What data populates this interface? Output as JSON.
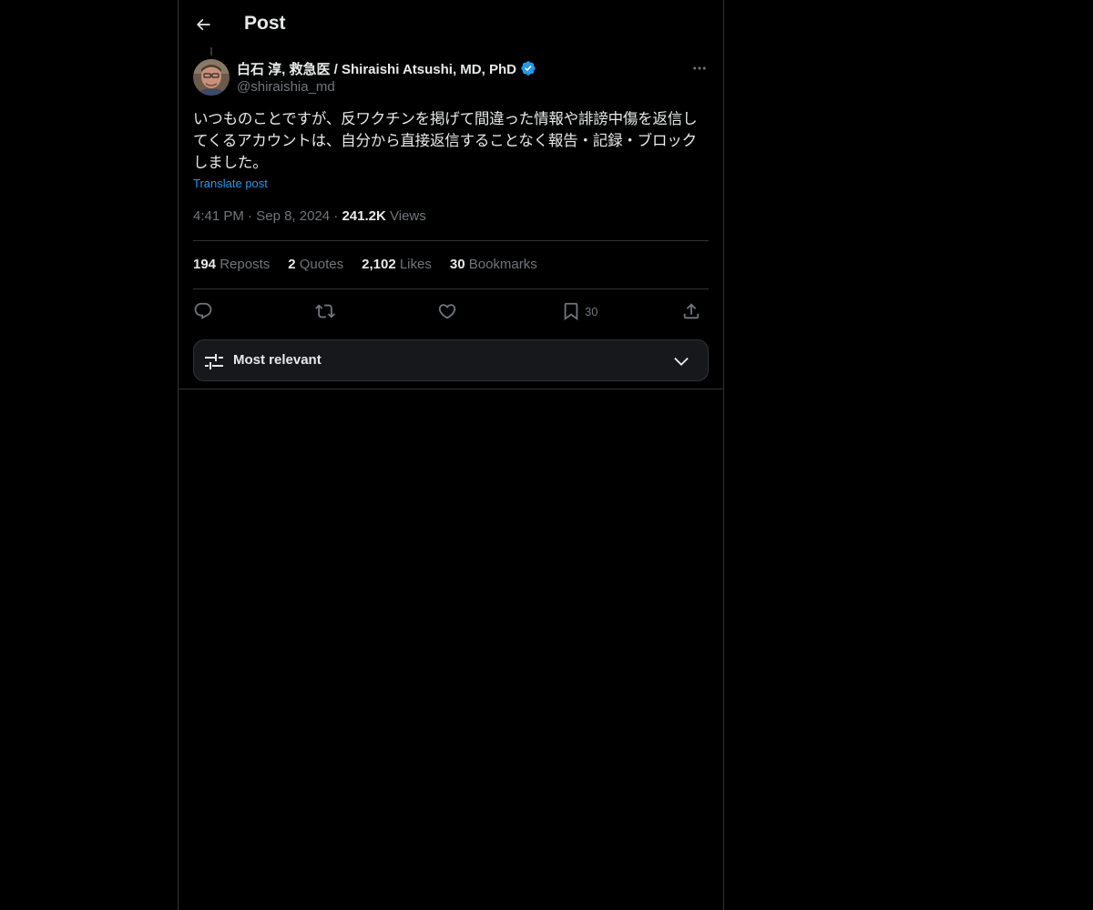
{
  "header": {
    "title": "Post",
    "back_icon": "arrow-left-icon"
  },
  "post": {
    "author": {
      "display_name": "白石 淳, 救急医 / Shiraishi Atsushi, MD, PhD",
      "handle": "@shiraishia_md",
      "verified": true,
      "verified_color": "#1d9bf0"
    },
    "text": "いつものことですが、反ワクチンを掲げて間違った情報や誹謗中傷を返信してくるアカウントは、自分から直接返信することなく報告・記録・ブロックしました。",
    "translate_label": "Translate post",
    "time": "4:41 PM",
    "date": "Sep 8, 2024",
    "separator": "·",
    "views_count": "241.2K",
    "views_label": "Views"
  },
  "stats": {
    "reposts": {
      "count": "194",
      "label": "Reposts"
    },
    "quotes": {
      "count": "2",
      "label": "Quotes"
    },
    "likes": {
      "count": "2,102",
      "label": "Likes"
    },
    "bookmarks": {
      "count": "30",
      "label": "Bookmarks"
    }
  },
  "actions": {
    "reply_icon": "reply-icon",
    "repost_icon": "repost-icon",
    "like_icon": "heart-icon",
    "bookmark_icon": "bookmark-icon",
    "bookmark_count": "30",
    "share_icon": "share-icon"
  },
  "sort": {
    "label": "Most relevant",
    "icon": "sliders-icon",
    "chevron": "chevron-down-icon"
  },
  "colors": {
    "background": "#000000",
    "text_primary": "#e7e9ea",
    "text_secondary": "#71767b",
    "accent": "#1d9bf0",
    "border": "#2f3336"
  }
}
